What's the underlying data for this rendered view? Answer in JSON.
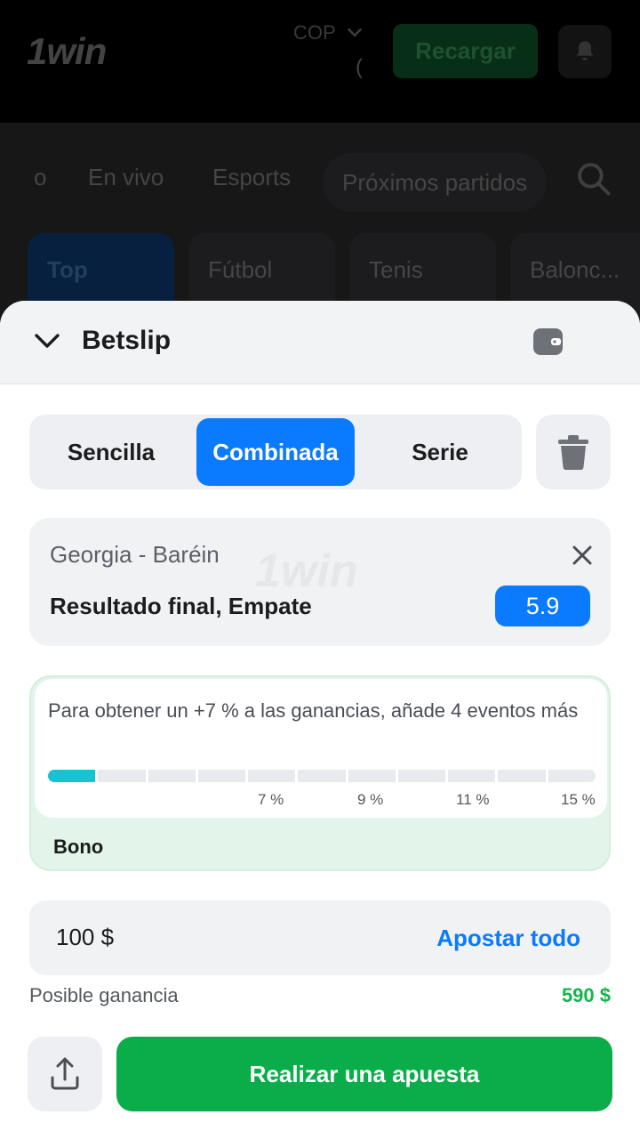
{
  "app": {
    "logo": "1win",
    "currency": "COP",
    "currency_sub": "(",
    "recharge_label": "Recargar"
  },
  "nav": {
    "items": [
      "o",
      "En vivo",
      "Esports",
      "Próximos partidos"
    ]
  },
  "categories": [
    "Top",
    "Fútbol",
    "Tenis",
    "Balonc..."
  ],
  "betslip": {
    "title": "Betslip",
    "tabs": [
      "Sencilla",
      "Combinada",
      "Serie"
    ],
    "active_tab": "Combinada",
    "event": {
      "match": "Georgia - Baréin",
      "watermark": "1win",
      "market": "Resultado final, Empate",
      "odds": "5.9"
    },
    "bonus": {
      "text": "Para obtener un +7 % a las ganancias, añade 4 eventos más",
      "progress_fraction": 0.09,
      "ticks": [
        "7 %",
        "9 %",
        "11 %",
        "15 %"
      ],
      "label": "Bono"
    },
    "stake": {
      "value": "100 $",
      "bet_all_label": "Apostar todo"
    },
    "possible_win_label": "Posible ganancia",
    "possible_win_value": "590 $",
    "place_bet_label": "Realizar una apuesta"
  },
  "colors": {
    "accent_blue": "#0a7aff",
    "green": "#0aad4a",
    "win_green": "#14b64a",
    "progress_cyan": "#17c2d2"
  }
}
